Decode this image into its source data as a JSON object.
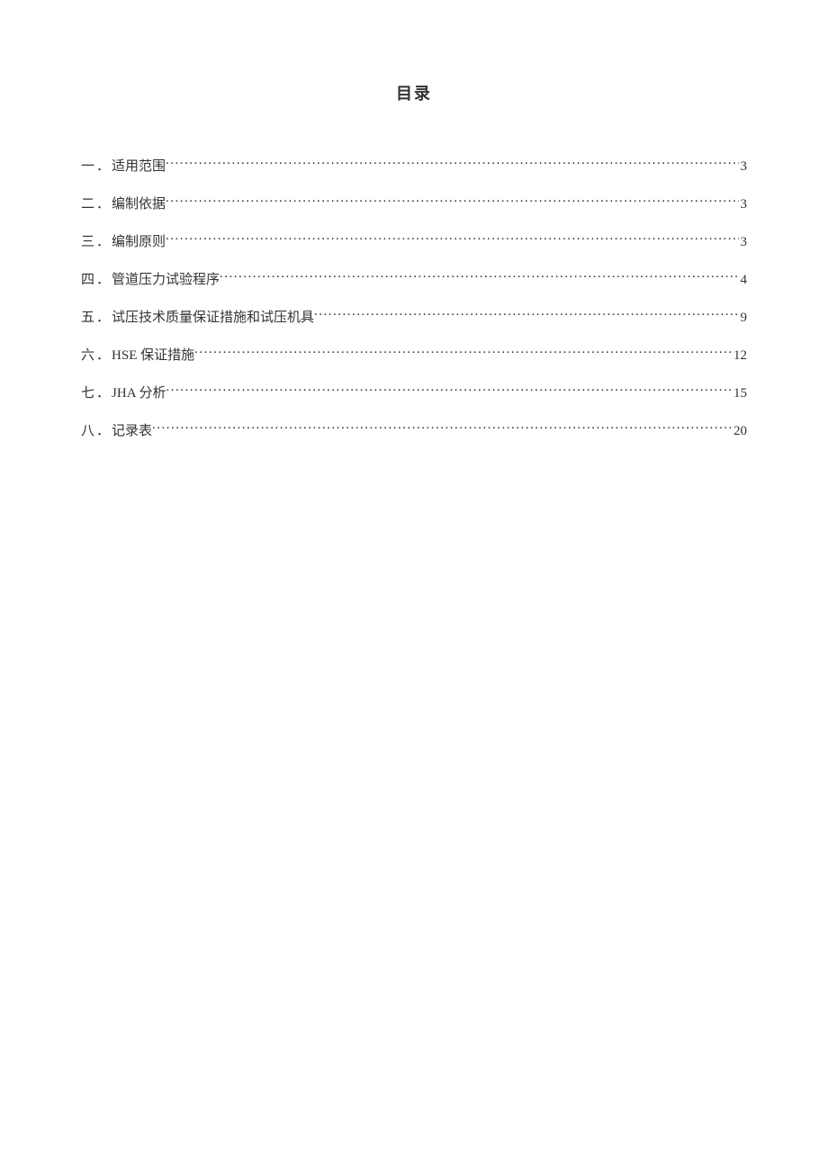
{
  "heading": "目录",
  "toc": [
    {
      "num": "一",
      "title": "适用范围",
      "page": "3"
    },
    {
      "num": "二",
      "title": "编制依据",
      "page": "3"
    },
    {
      "num": "三",
      "title": "编制原则",
      "page": "3"
    },
    {
      "num": "四",
      "title": "管道压力试验程序",
      "page": "4"
    },
    {
      "num": "五",
      "title": "试压技术质量保证措施和试压机具",
      "page": "9"
    },
    {
      "num": "六",
      "title": "HSE 保证措施",
      "page": "12"
    },
    {
      "num": "七",
      "title": "JHA 分析",
      "page": "15"
    },
    {
      "num": "八",
      "title": "记录表",
      "page": "20"
    }
  ],
  "separator": "．"
}
